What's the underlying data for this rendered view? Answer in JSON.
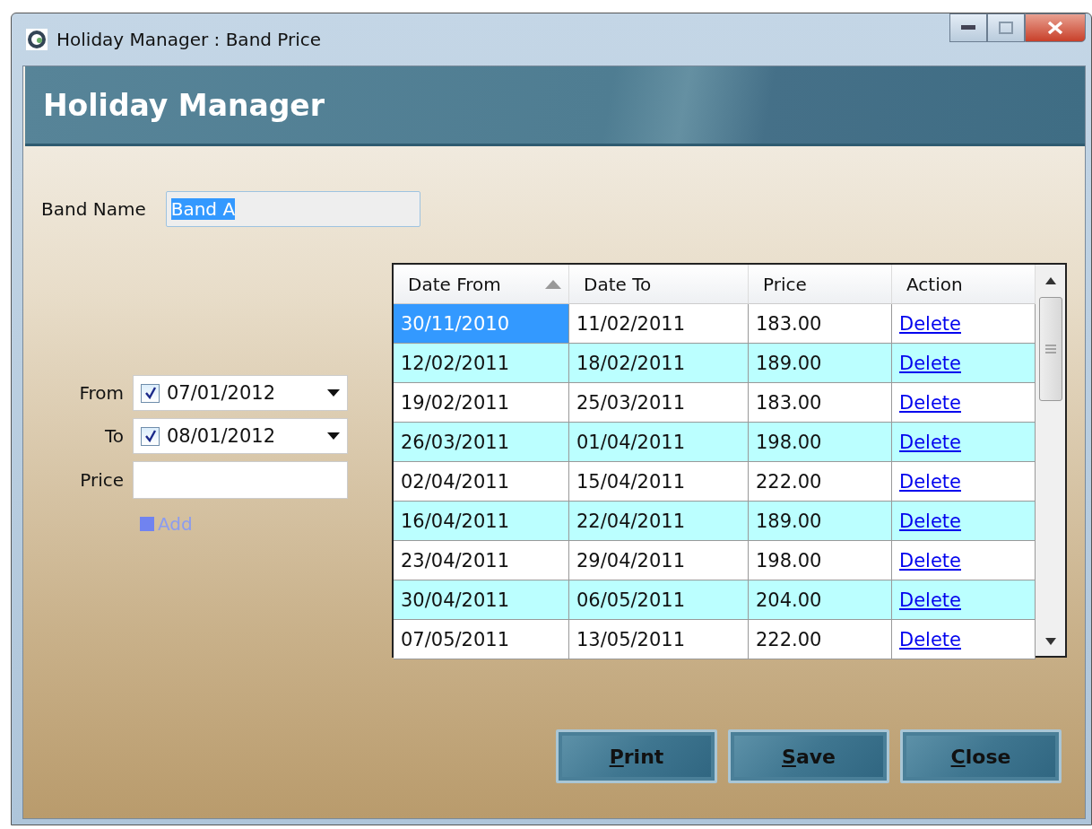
{
  "window": {
    "title": "Holiday Manager : Band Price"
  },
  "header": {
    "title": "Holiday Manager"
  },
  "band_name": {
    "label": "Band Name",
    "value": "Band A",
    "selected": true
  },
  "form": {
    "from": {
      "label": "From",
      "value": "07/01/2012",
      "checked": true
    },
    "to": {
      "label": "To",
      "value": "08/01/2012",
      "checked": true
    },
    "price": {
      "label": "Price"
    },
    "add": {
      "label": "Add",
      "disabled": true
    }
  },
  "table": {
    "columns": [
      {
        "label": "Date From",
        "sorted": true
      },
      {
        "label": "Date To",
        "sorted": false
      },
      {
        "label": "Price",
        "sorted": false
      },
      {
        "label": "Action",
        "sorted": false
      }
    ],
    "rows": [
      {
        "date_from": "30/11/2010",
        "date_to": "11/02/2011",
        "price": "183.00",
        "action": "Delete",
        "selected": true
      },
      {
        "date_from": "12/02/2011",
        "date_to": "18/02/2011",
        "price": "189.00",
        "action": "Delete",
        "selected": false
      },
      {
        "date_from": "19/02/2011",
        "date_to": "25/03/2011",
        "price": "183.00",
        "action": "Delete",
        "selected": false
      },
      {
        "date_from": "26/03/2011",
        "date_to": "01/04/2011",
        "price": "198.00",
        "action": "Delete",
        "selected": false
      },
      {
        "date_from": "02/04/2011",
        "date_to": "15/04/2011",
        "price": "222.00",
        "action": "Delete",
        "selected": false
      },
      {
        "date_from": "16/04/2011",
        "date_to": "22/04/2011",
        "price": "189.00",
        "action": "Delete",
        "selected": false
      },
      {
        "date_from": "23/04/2011",
        "date_to": "29/04/2011",
        "price": "198.00",
        "action": "Delete",
        "selected": false
      },
      {
        "date_from": "30/04/2011",
        "date_to": "06/05/2011",
        "price": "204.00",
        "action": "Delete",
        "selected": false
      },
      {
        "date_from": "07/05/2011",
        "date_to": "13/05/2011",
        "price": "222.00",
        "action": "Delete",
        "selected": false
      }
    ]
  },
  "buttons": [
    {
      "label": "Print",
      "underline_first": true
    },
    {
      "label": "Save",
      "underline_first": true
    },
    {
      "label": "Close",
      "underline_first": true
    }
  ]
}
